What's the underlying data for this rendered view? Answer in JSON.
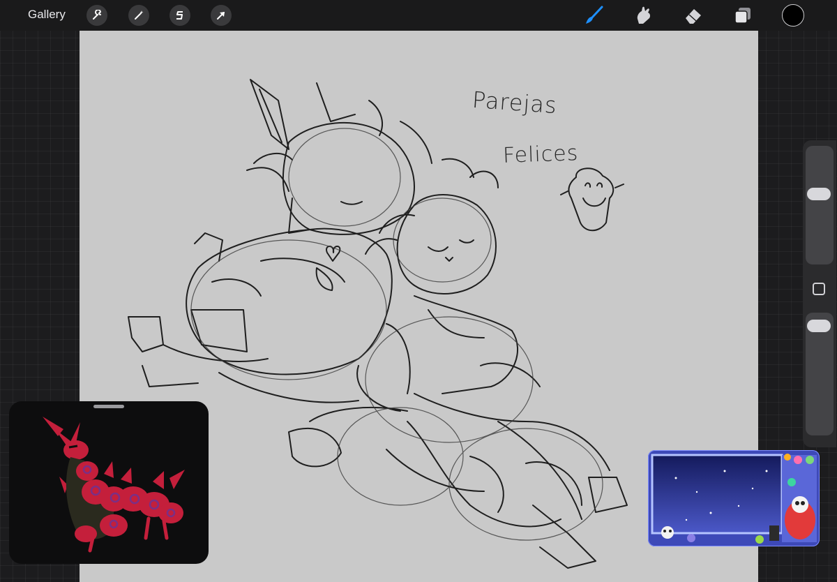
{
  "toolbar": {
    "gallery_label": "Gallery",
    "left_tools": [
      "actions-wrench-icon",
      "adjustments-wand-icon",
      "selection-s-icon",
      "transform-arrow-icon"
    ],
    "right_tools": [
      "brush-icon",
      "smudge-icon",
      "eraser-icon",
      "layers-icon"
    ],
    "active_tool": "brush",
    "active_color": "#000000",
    "accent_color": "#1e90ff"
  },
  "canvas": {
    "background_color": "#c9c9c9",
    "handwritten_text": [
      "Parejas",
      "Felices"
    ]
  },
  "sidebar": {
    "brush_size_level": 0.25,
    "brush_opacity_level": 0.05
  },
  "windows": {
    "reference_window": "Reference image of a red and black centipede creature",
    "pip_window": "Stream overlay preview"
  }
}
